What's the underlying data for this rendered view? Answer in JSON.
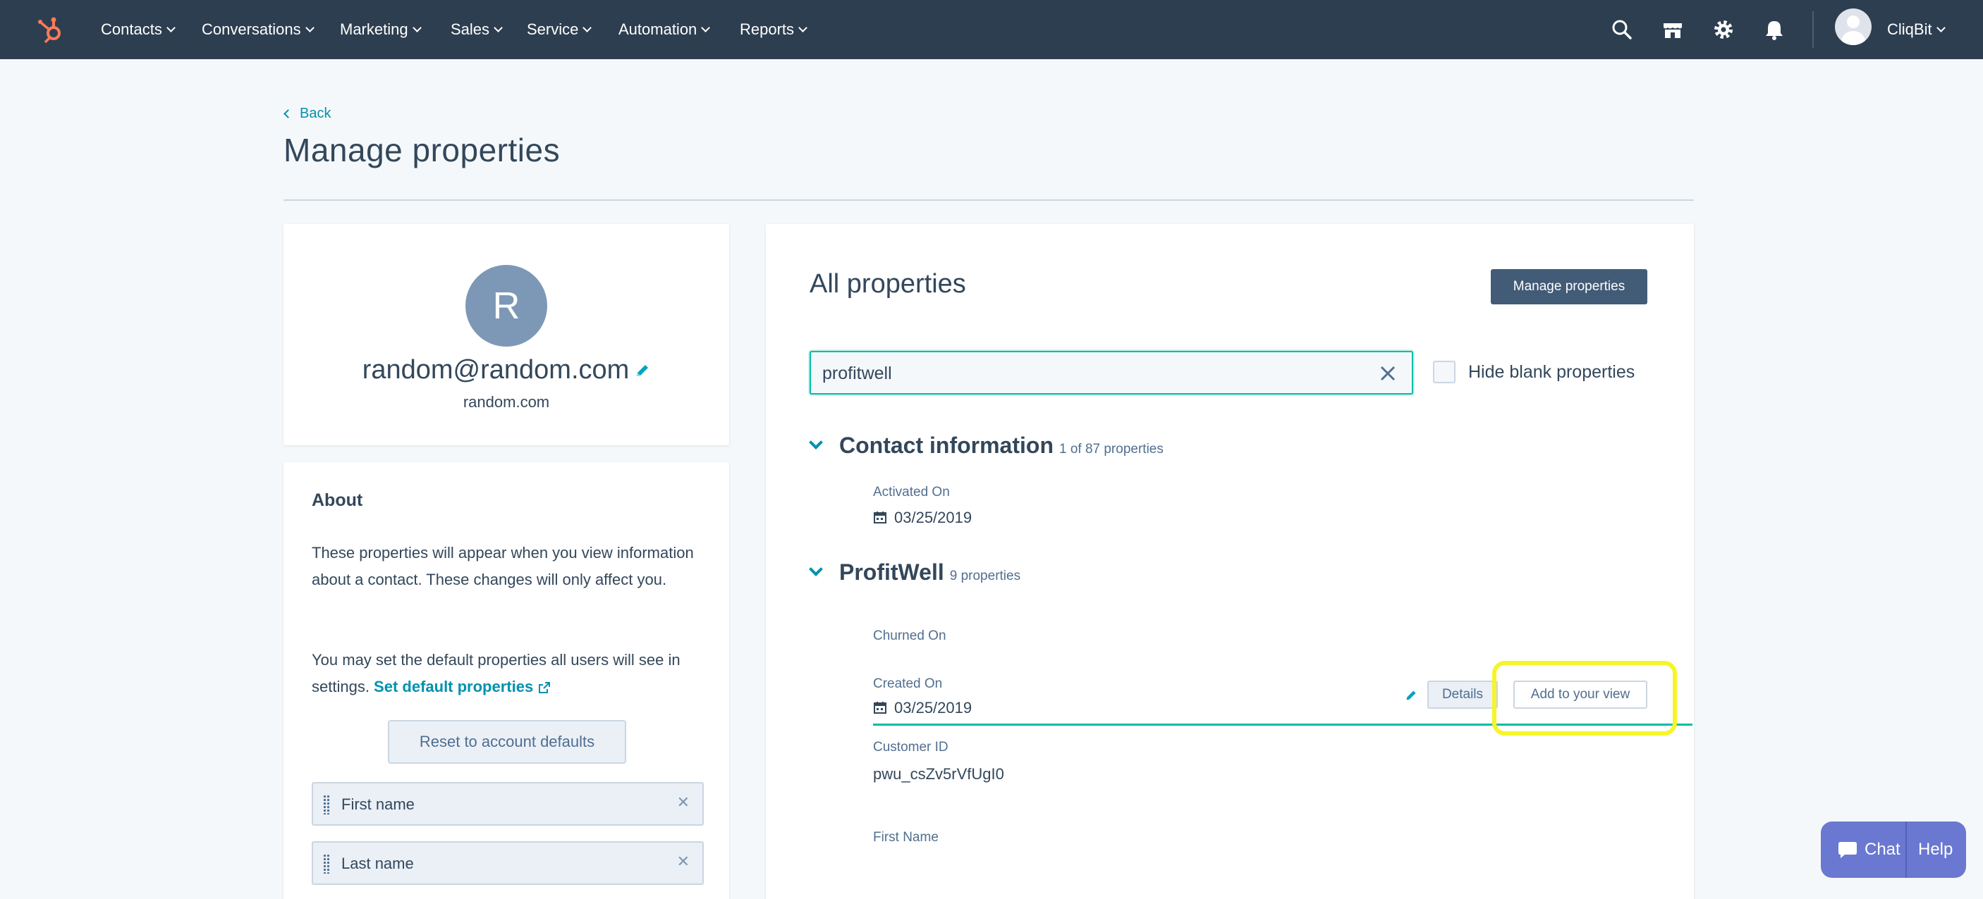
{
  "nav": {
    "items": [
      "Contacts",
      "Conversations",
      "Marketing",
      "Sales",
      "Service",
      "Automation",
      "Reports"
    ],
    "account_name": "CliqBit"
  },
  "header": {
    "back_label": "Back",
    "title": "Manage properties"
  },
  "profile": {
    "initial": "R",
    "email": "random@random.com",
    "domain": "random.com"
  },
  "about": {
    "title": "About",
    "text1": "These properties will appear when you view information about a contact. These changes will only affect you.",
    "text2_prefix": "You may set the default properties all users will see in settings. ",
    "text2_link": "Set default properties",
    "reset_label": "Reset to account defaults",
    "chips": [
      "First name",
      "Last name"
    ]
  },
  "properties": {
    "title": "All properties",
    "manage_label": "Manage properties",
    "search_value": "profitwell",
    "hide_blank_label": "Hide blank properties",
    "groups": [
      {
        "name": "Contact information",
        "count": "1 of 87 properties",
        "items": [
          {
            "label": "Activated On",
            "value": "03/25/2019"
          }
        ]
      },
      {
        "name": "ProfitWell",
        "count": "9 properties",
        "items": [
          {
            "label": "Churned On",
            "value": ""
          },
          {
            "label": "Created On",
            "value": "03/25/2019"
          },
          {
            "label": "Customer ID",
            "value": "pwu_csZv5rVfUgI0"
          },
          {
            "label": "First Name",
            "value": ""
          }
        ]
      }
    ],
    "details_label": "Details",
    "add_view_label": "Add to your view"
  },
  "chat": {
    "chat_label": "Chat",
    "help_label": "Help"
  },
  "colors": {
    "nav_bg": "#2d3e50",
    "accent": "#0091ae",
    "teal": "#00bda5",
    "highlight": "#f5f52a",
    "chat": "#6a78d1"
  }
}
